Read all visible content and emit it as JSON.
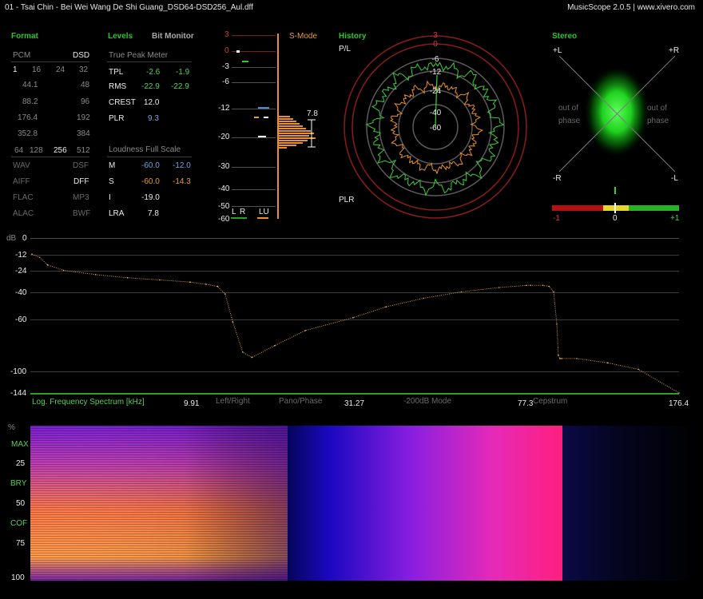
{
  "title_bar": {
    "file": "01 - Tsai Chin - Bei Wei Wang De Shi Guang_DSD64-DSD256_Aul.dff",
    "app": "MusicScope 2.0.5 | www.xivero.com"
  },
  "format": {
    "header": "Format",
    "pcm_label": "PCM",
    "dsd_label": "DSD",
    "row1": [
      "1",
      "16",
      "24",
      "32"
    ],
    "pcm_rates": [
      "44.1",
      "88.2",
      "176.4",
      "352.8"
    ],
    "dsd_rates": [
      "48",
      "96",
      "192",
      "384"
    ],
    "dsd_row": [
      "64",
      "128",
      "256",
      "512"
    ],
    "file_types": [
      [
        "WAV",
        "DSF"
      ],
      [
        "AIFF",
        "DFF"
      ],
      [
        "FLAC",
        "MP3"
      ],
      [
        "ALAC",
        "BWF"
      ]
    ]
  },
  "levels": {
    "header": "Levels",
    "bit_monitor": "Bit Monitor",
    "true_peak_title": "True Peak Meter",
    "rows": [
      {
        "label": "TPL",
        "left": "-2.6",
        "right": "-1.9"
      },
      {
        "label": "RMS",
        "left": "-22.9",
        "right": "-22.9"
      },
      {
        "label": "CREST",
        "value": "12.0"
      },
      {
        "label": "PLR",
        "value": "9.3"
      }
    ],
    "loudness_title": "Loudness Full Scale",
    "loudness_rows": [
      {
        "label": "M",
        "left": "-60.0",
        "right": "-12.0"
      },
      {
        "label": "S",
        "left": "-60.0",
        "right": "-14.3"
      },
      {
        "label": "I",
        "value": "-19.0"
      },
      {
        "label": "LRA",
        "value": "7.8"
      }
    ]
  },
  "meter": {
    "scale": [
      "3",
      "0",
      "-3",
      "-6",
      "-12",
      "-20",
      "-30",
      "-40",
      "-50",
      "-60"
    ],
    "s_mode": "S-Mode",
    "lra_value": "7.8",
    "channels": [
      "L",
      "R",
      "LU"
    ]
  },
  "history": {
    "header": "History",
    "pl_label": "P/L",
    "plr_label": "PLR",
    "rings": [
      "3",
      "0",
      "-6",
      "-12",
      "-24",
      "-40",
      "-60"
    ]
  },
  "stereo": {
    "header": "Stereo",
    "corners": [
      "+L",
      "+R",
      "-R",
      "-L"
    ],
    "out_of_phase": [
      "out of",
      "phase"
    ],
    "balance_labels": [
      "-1",
      "0",
      "+1"
    ]
  },
  "spectrum": {
    "y_labels": [
      "dB",
      "0",
      "-12",
      "-24",
      "-40",
      "-60",
      "-100",
      "-144"
    ],
    "title": "Log. Frequency Spectrum [kHz]",
    "x_labels": [
      "9.91",
      "31.27",
      "77.3",
      "176.4"
    ],
    "buttons": [
      "Left/Right",
      "Pano/Phase",
      "-200dB Mode",
      "Cepstrum"
    ]
  },
  "chart_data": {
    "type": "line",
    "xlabel": "Log. Frequency Spectrum [kHz]",
    "ylabel": "dB",
    "ylim": [
      -144,
      0
    ],
    "x_ticks": [
      9.91,
      31.27,
      77.3,
      176.4
    ],
    "series": [
      {
        "name": "",
        "x": [
          0.02,
          0.5,
          1,
          2,
          4,
          6,
          8,
          9.91,
          12,
          13.5,
          14.5,
          15.5,
          16.8,
          18,
          21,
          25,
          31.27,
          40,
          50,
          60,
          70,
          77.3,
          80,
          88,
          92,
          95,
          97,
          98,
          99,
          100,
          110,
          130,
          150,
          176.4
        ],
        "y": [
          -15,
          -18,
          -25,
          -30,
          -34,
          -37,
          -39,
          -41,
          -43,
          -45,
          -52,
          -78,
          -106,
          -111,
          -100,
          -86,
          -74,
          -64,
          -56,
          -50,
          -46,
          -44,
          -44,
          -44,
          -45,
          -50,
          -80,
          -109,
          -112,
          -112,
          -112,
          -116,
          -122,
          -144
        ]
      }
    ]
  },
  "spectrogram": {
    "y_labels": [
      "%",
      "MAX",
      "25",
      "BRY",
      "50",
      "COF",
      "75",
      "100"
    ]
  }
}
